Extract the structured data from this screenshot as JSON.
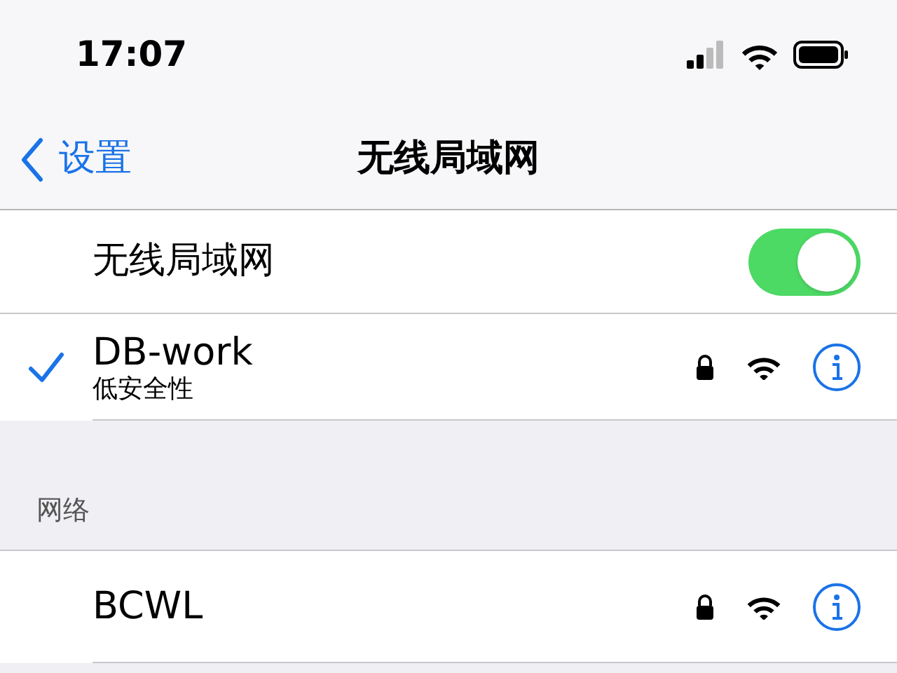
{
  "status_bar": {
    "time": "17:07"
  },
  "nav": {
    "back": "设置",
    "title": "无线局域网"
  },
  "wifi_toggle": {
    "label": "无线局域网",
    "on": true
  },
  "current_network": {
    "name": "DB-work",
    "subtitle": "低安全性",
    "selected": true,
    "locked": true
  },
  "section_header": "网络",
  "networks": [
    {
      "name": "BCWL",
      "selected": false,
      "locked": true
    }
  ]
}
